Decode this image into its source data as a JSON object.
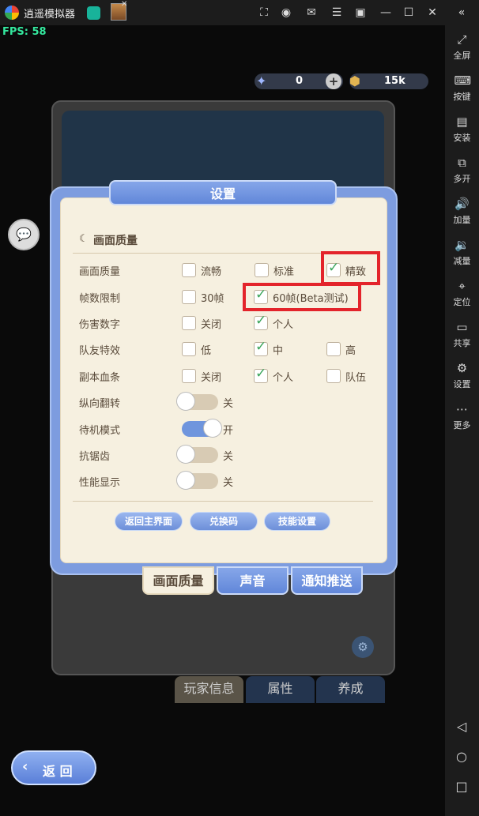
{
  "app": {
    "title": "逍遥模拟器"
  },
  "fps": "FPS: 58",
  "sidebar": [
    {
      "label": "全屏",
      "icon": "fullscreen-icon"
    },
    {
      "label": "按键",
      "icon": "keyboard-icon"
    },
    {
      "label": "安装",
      "icon": "apk-icon"
    },
    {
      "label": "多开",
      "icon": "multi-instance-icon"
    },
    {
      "label": "加量",
      "icon": "volume-up-icon"
    },
    {
      "label": "减量",
      "icon": "volume-down-icon"
    },
    {
      "label": "定位",
      "icon": "location-icon"
    },
    {
      "label": "共享",
      "icon": "folder-icon"
    },
    {
      "label": "设置",
      "icon": "gear-icon"
    },
    {
      "label": "更多",
      "icon": "more-icon"
    }
  ],
  "currency": {
    "gems": "0",
    "coins": "15k"
  },
  "dialog": {
    "title": "设置",
    "section": "画面质量",
    "rows": {
      "quality": {
        "label": "画面质量",
        "opt1": "流畅",
        "opt2": "标准",
        "opt3": "精致"
      },
      "fps": {
        "label": "帧数限制",
        "opt1": "30帧",
        "opt2": "60帧(Beta测试)"
      },
      "damage": {
        "label": "伤害数字",
        "opt1": "关闭",
        "opt2": "个人"
      },
      "teammate": {
        "label": "队友特效",
        "opt1": "低",
        "opt2": "中",
        "opt3": "高"
      },
      "dungeon": {
        "label": "副本血条",
        "opt1": "关闭",
        "opt2": "个人",
        "opt3": "队伍"
      }
    },
    "toggles": [
      {
        "label": "纵向翻转",
        "state": "关",
        "on": false
      },
      {
        "label": "待机模式",
        "state": "开",
        "on": true
      },
      {
        "label": "抗锯齿",
        "state": "关",
        "on": false
      },
      {
        "label": "性能显示",
        "state": "关",
        "on": false
      }
    ],
    "buttons": {
      "main_menu": "返回主界面",
      "redeem": "兑换码",
      "skill": "技能设置"
    },
    "tabs": {
      "graphics": "画面质量",
      "sound": "声音",
      "notify": "通知推送"
    }
  },
  "bottom_tabs": {
    "player": "玩家信息",
    "attr": "属性",
    "grow": "养成"
  },
  "back_button": "返 回"
}
